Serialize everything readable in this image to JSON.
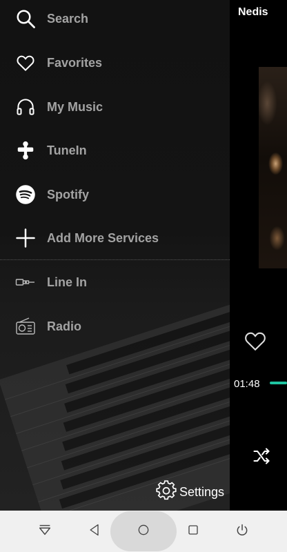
{
  "player": {
    "title": "Nedis",
    "elapsed": "01:48",
    "accent_color": "#1fc4a1"
  },
  "drawer": {
    "items": [
      {
        "label": "Search",
        "icon": "search-icon"
      },
      {
        "label": "Favorites",
        "icon": "heart-icon"
      },
      {
        "label": "My Music",
        "icon": "headphones-icon"
      },
      {
        "label": "TuneIn",
        "icon": "tunein-icon"
      },
      {
        "label": "Spotify",
        "icon": "spotify-icon"
      },
      {
        "label": "Add More Services",
        "icon": "plus-icon"
      },
      {
        "label": "Line In",
        "icon": "line-in-icon"
      },
      {
        "label": "Radio",
        "icon": "radio-icon"
      }
    ],
    "settings_label": "Settings"
  },
  "navbar": {
    "buttons": [
      "hide-keyboard-icon",
      "back-icon",
      "home-icon",
      "recents-icon",
      "power-icon"
    ]
  }
}
